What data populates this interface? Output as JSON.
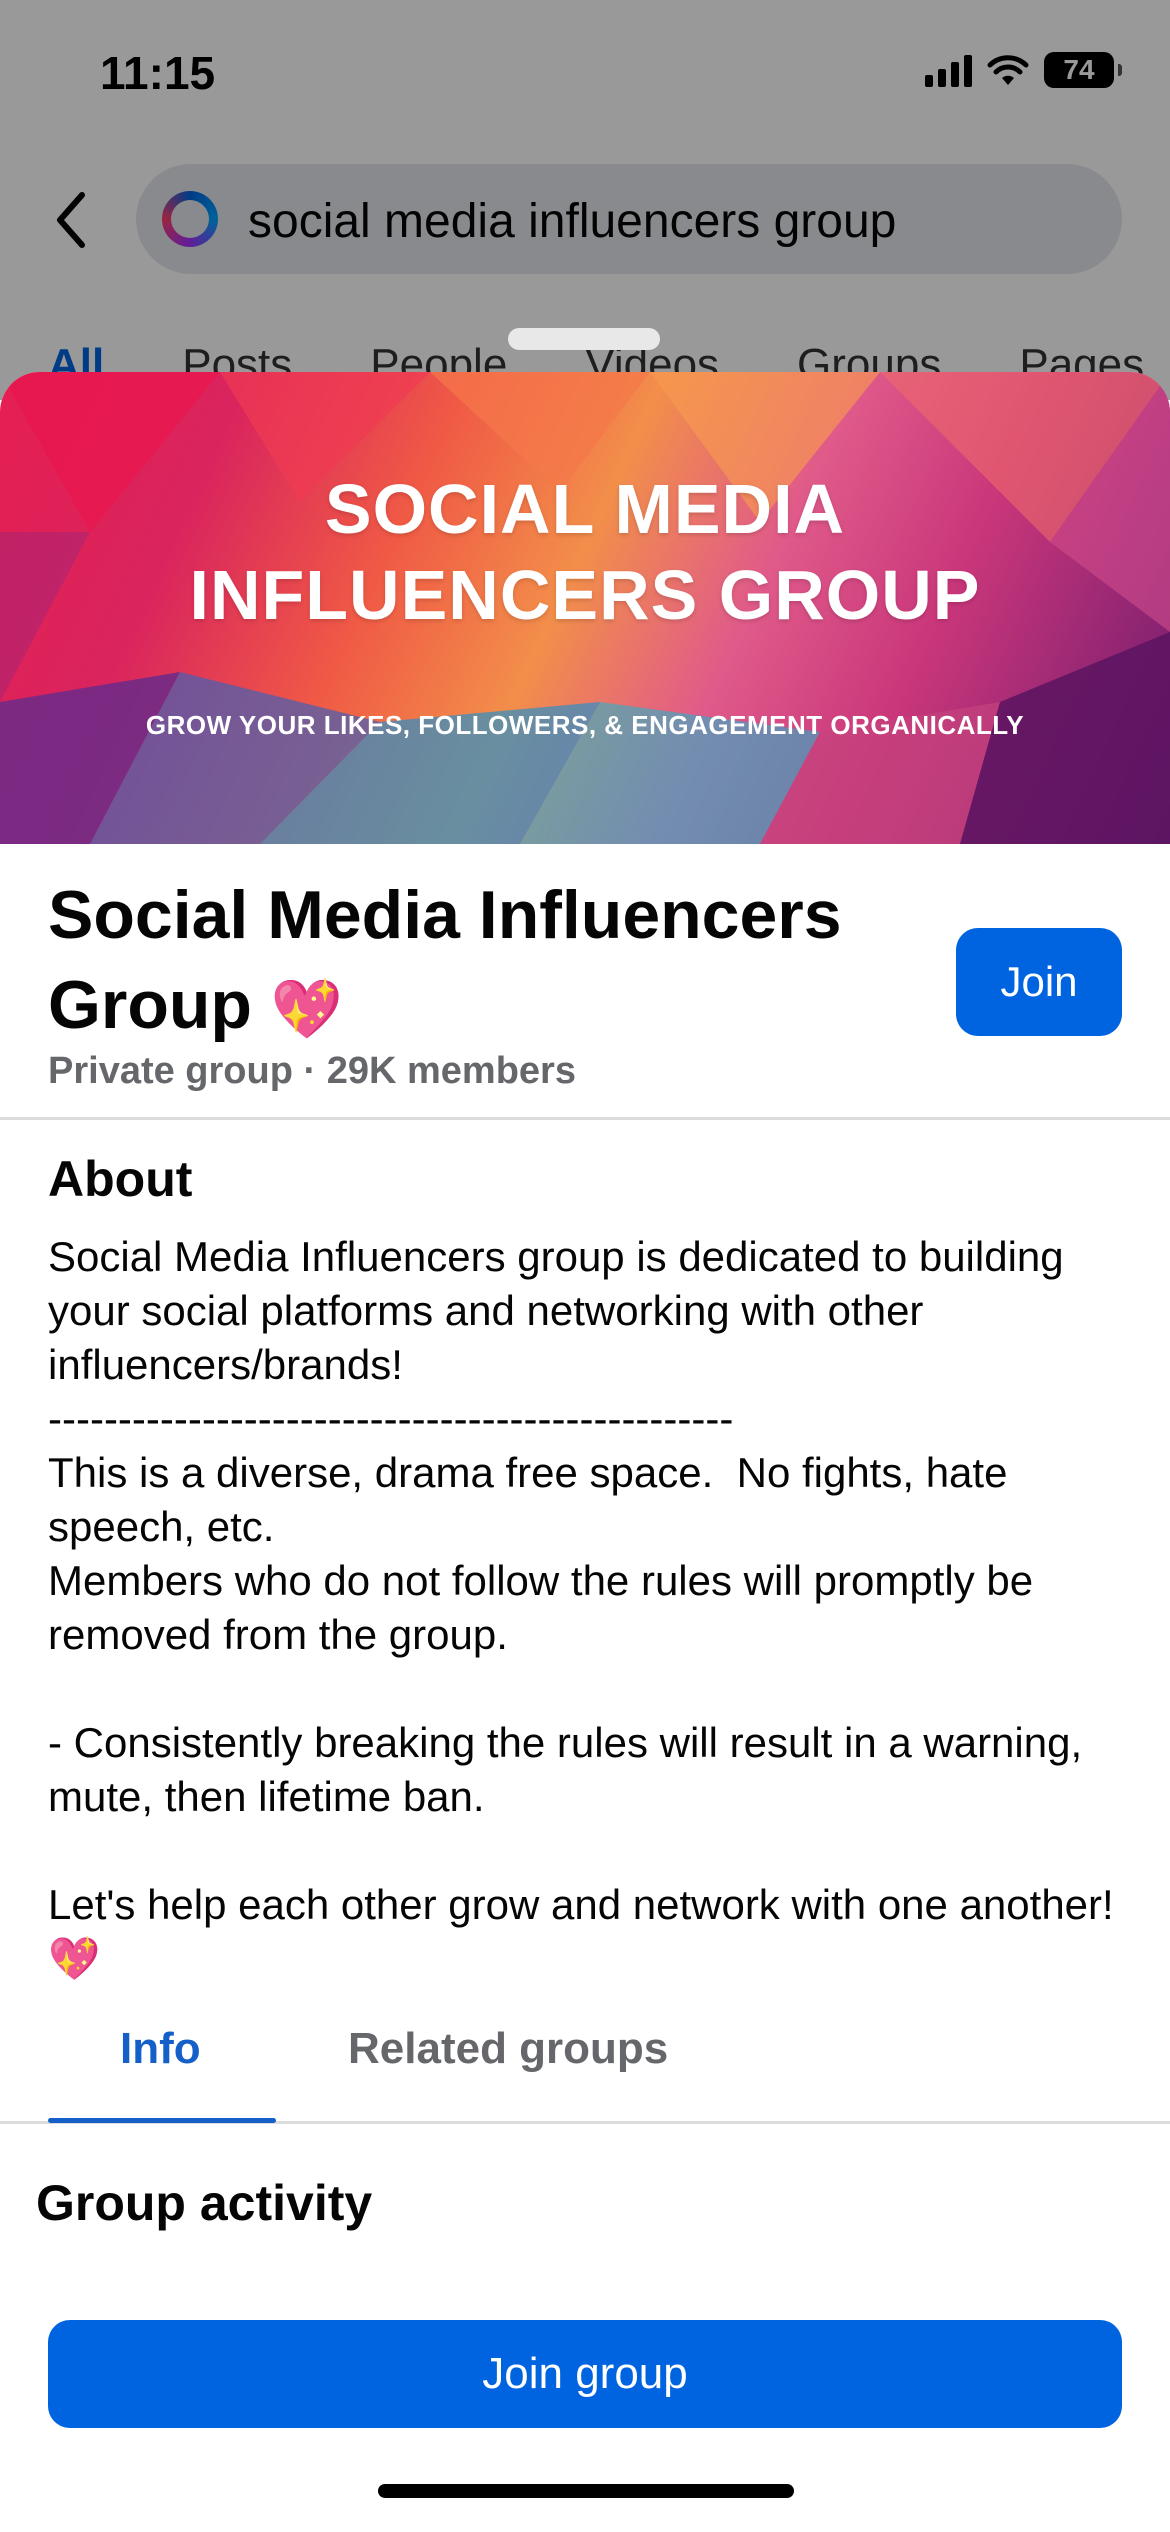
{
  "status_bar": {
    "time": "11:15",
    "battery": "74"
  },
  "search": {
    "query": "social media influencers group"
  },
  "filter_tabs": [
    "All",
    "Posts",
    "People",
    "Videos",
    "Groups",
    "Pages"
  ],
  "cover": {
    "title_line1": "SOCIAL MEDIA",
    "title_line2": "INFLUENCERS GROUP",
    "subtitle": "GROW YOUR LIKES, FOLLOWERS, & ENGAGEMENT ORGANICALLY"
  },
  "group": {
    "name": "Social Media Influencers Group",
    "emoji": "💖",
    "meta": "Private group · 29K members",
    "join_label": "Join"
  },
  "about": {
    "title": "About",
    "body": "Social Media Influencers group is dedicated to building your social platforms and networking with other influencers/brands!\n-------------------------------------------------\nThis is a diverse, drama free space.  No fights, hate speech, etc.\nMembers who do not follow the rules will promptly be removed from the group.\n\n- Consistently breaking the rules will result in a warning, mute, then lifetime ban.\n\nLet's help each other grow and network with one another! 💖"
  },
  "tabs": {
    "info": "Info",
    "related": "Related groups"
  },
  "activity": {
    "title": "Group activity"
  },
  "join_group_label": "Join group",
  "colors": {
    "accent": "#0064e0",
    "tab_active": "#1460c8",
    "meta_gray": "#65676b"
  },
  "icons": [
    "back-arrow-icon",
    "search-logo-icon",
    "signal-icon",
    "wifi-icon",
    "battery-icon",
    "sparkling-heart-icon"
  ]
}
